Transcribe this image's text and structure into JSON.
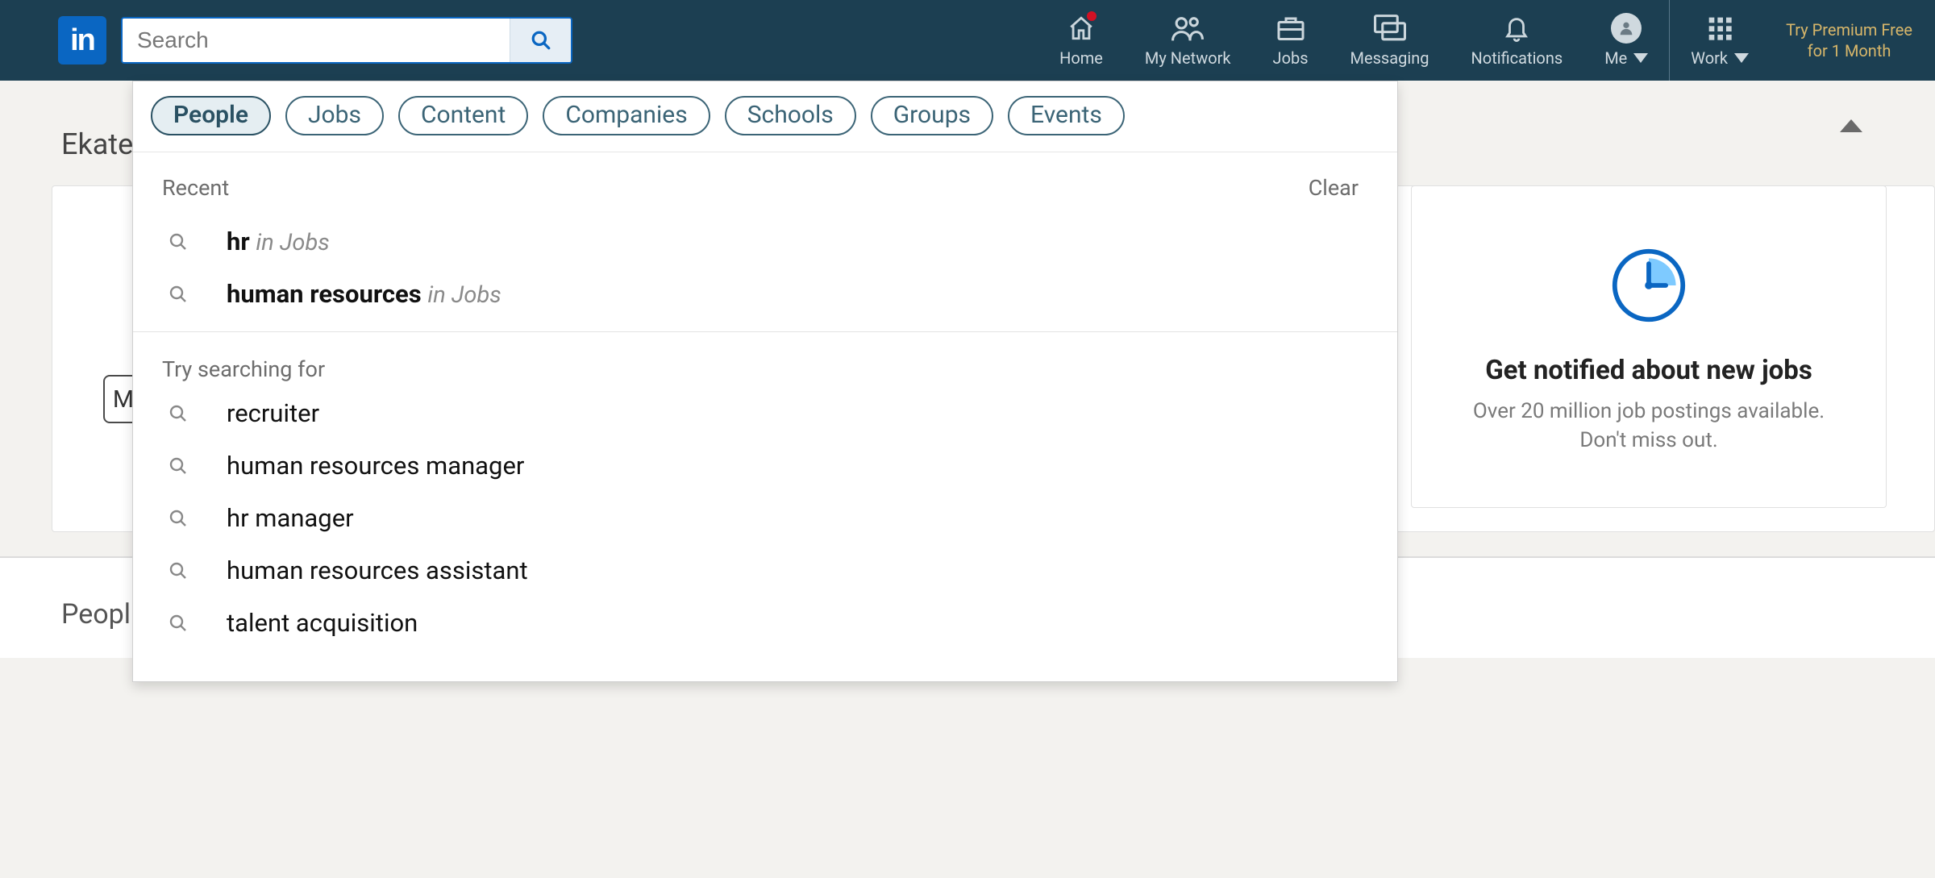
{
  "search": {
    "placeholder": "Search"
  },
  "nav": {
    "home": "Home",
    "network": "My Network",
    "jobs": "Jobs",
    "messaging": "Messaging",
    "notifications": "Notifications",
    "me": "Me",
    "work": "Work"
  },
  "premium": {
    "line1": "Try Premium Free",
    "line2": "for 1 Month"
  },
  "dropdown": {
    "chips": {
      "people": "People",
      "jobs": "Jobs",
      "content": "Content",
      "companies": "Companies",
      "schools": "Schools",
      "groups": "Groups",
      "events": "Events"
    },
    "recent_label": "Recent",
    "clear_label": "Clear",
    "recent": [
      {
        "term": "hr",
        "context": "in Jobs"
      },
      {
        "term": "human resources",
        "context": "in Jobs"
      }
    ],
    "try_label": "Try searching for",
    "suggestions": [
      "recruiter",
      "human resources manager",
      "hr manager",
      "human resources assistant",
      "talent acquisition"
    ]
  },
  "page": {
    "truncated_name": "Ekate",
    "people_row_label": "Peopl",
    "hidden_box_letter": "M"
  },
  "right_card": {
    "title": "Get notified about new jobs",
    "line1": "Over 20 million job postings available.",
    "line2": "Don't miss out."
  }
}
